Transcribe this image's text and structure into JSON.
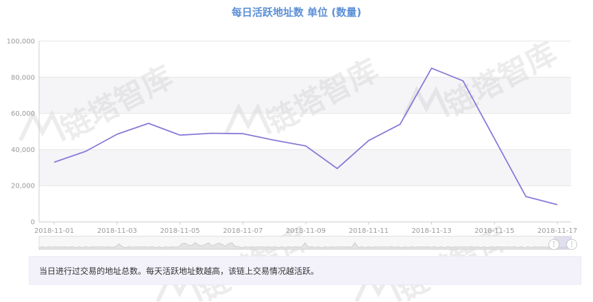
{
  "title": "每日活跃地址数 单位 (数量)",
  "description": "当日进行过交易的地址总数。每天活跃地址数越高，该链上交易情况越活跃。",
  "watermark": "链塔智库",
  "colors": {
    "line": "#8a78d6",
    "title": "#5b8fd6",
    "band": "#f5f5f8"
  },
  "chart_data": {
    "type": "line",
    "title": "每日活跃地址数 单位 (数量)",
    "xlabel": "",
    "ylabel": "",
    "x": [
      "2018-11-01",
      "2018-11-02",
      "2018-11-03",
      "2018-11-04",
      "2018-11-05",
      "2018-11-06",
      "2018-11-07",
      "2018-11-08",
      "2018-11-09",
      "2018-11-10",
      "2018-11-11",
      "2018-11-12",
      "2018-11-13",
      "2018-11-14",
      "2018-11-15",
      "2018-11-16",
      "2018-11-17"
    ],
    "x_tick_labels": [
      "2018-11-01",
      "2018-11-03",
      "2018-11-05",
      "2018-11-07",
      "2018-11-09",
      "2018-11-11",
      "2018-11-13",
      "2018-11-15",
      "2018-11-17"
    ],
    "y_tick_labels": [
      "0",
      "20,000",
      "40,000",
      "60,000",
      "80,000",
      "100,000"
    ],
    "ylim": [
      0,
      100000
    ],
    "grid": true,
    "series": [
      {
        "values": [
          33000,
          39000,
          48500,
          54500,
          48000,
          49000,
          48800,
          45200,
          42000,
          29500,
          45000,
          54000,
          85000,
          78000,
          46000,
          14000,
          9500
        ]
      }
    ]
  },
  "data_zoom": {
    "start_handle_icon": "grip-icon",
    "end_handle_icon": "grip-icon"
  }
}
